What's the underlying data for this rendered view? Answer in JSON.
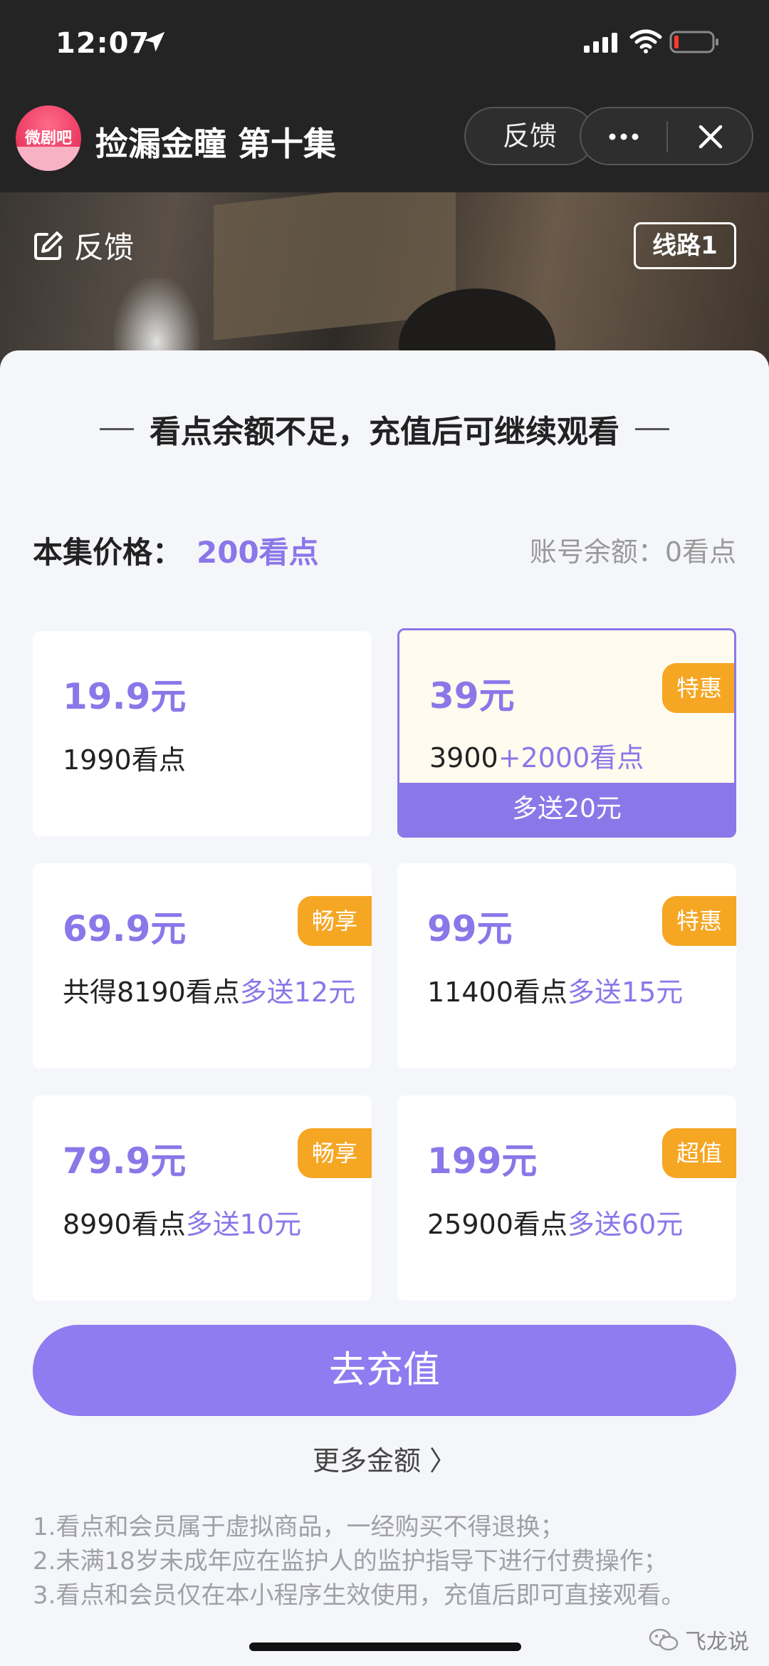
{
  "status_bar": {
    "time": "12:07",
    "icons": [
      "location-arrow-icon",
      "cellular-signal-icon",
      "wifi-icon",
      "battery-low-icon"
    ]
  },
  "nav": {
    "logo_text": "微剧吧",
    "title": "捡漏金瞳 第十集",
    "feedback_label": "反馈",
    "more_icon": "more-dots-icon",
    "close_icon": "close-icon"
  },
  "video": {
    "feedback_label": "反馈",
    "route_label": "线路1"
  },
  "sheet": {
    "title": "看点余额不足，充值后可继续观看",
    "price_label": "本集价格：",
    "price_value": "200看点",
    "balance": "账号余额：0看点",
    "packages": [
      {
        "amount": "19.9元",
        "points": "1990看点",
        "bonus": "",
        "tag": "",
        "extra": "",
        "selected": false
      },
      {
        "amount": "39元",
        "points": "3900",
        "bonus": "+2000看点",
        "tag": "特惠",
        "extra": "多送20元",
        "selected": true
      },
      {
        "amount": "69.9元",
        "points": "共得8190看点",
        "bonus": "多送12元",
        "tag": "畅享",
        "extra": "",
        "selected": false
      },
      {
        "amount": "99元",
        "points": "11400看点",
        "bonus": "多送15元",
        "tag": "特惠",
        "extra": "",
        "selected": false
      },
      {
        "amount": "79.9元",
        "points": "8990看点",
        "bonus": "多送10元",
        "tag": "畅享",
        "extra": "",
        "selected": false
      },
      {
        "amount": "199元",
        "points": "25900看点",
        "bonus": "多送60元",
        "tag": "超值",
        "extra": "",
        "selected": false
      }
    ],
    "cta_label": "去充值",
    "more_amount_label": "更多金额 〉",
    "notes": [
      "1.看点和会员属于虚拟商品，一经购买不得退换；",
      "2.未满18岁未成年应在监护人的监护指导下进行付费操作；",
      "3.看点和会员仅在本小程序生效使用，充值后即可直接观看。"
    ],
    "watermark": "飞龙说"
  },
  "colors": {
    "accent": "#8a77e8",
    "tag": "#f5a623",
    "selected_bg": "#fffbee",
    "sheet_bg": "#f5f6fa"
  }
}
